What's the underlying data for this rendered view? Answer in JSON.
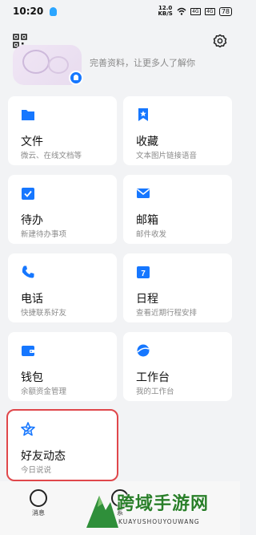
{
  "status_bar": {
    "time": "10:20",
    "speed_top": "12.0",
    "speed_bottom": "KB/S",
    "sig1": "4G",
    "sig2": "4G",
    "battery": "78"
  },
  "profile": {
    "hint": "完善资料，让更多人了解你"
  },
  "cards": [
    {
      "title": "文件",
      "sub": "微云、在线文档等",
      "icon": "folder-icon"
    },
    {
      "title": "收藏",
      "sub": "文本图片链接语音",
      "icon": "bookmark-star-icon"
    },
    {
      "title": "待办",
      "sub": "新建待办事项",
      "icon": "todo-check-icon"
    },
    {
      "title": "邮箱",
      "sub": "邮件收发",
      "icon": "mail-icon"
    },
    {
      "title": "电话",
      "sub": "快捷联系好友",
      "icon": "phone-icon"
    },
    {
      "title": "日程",
      "sub": "查看近期行程安排",
      "icon": "calendar-icon"
    },
    {
      "title": "钱包",
      "sub": "余额资金管理",
      "icon": "wallet-icon"
    },
    {
      "title": "工作台",
      "sub": "我的工作台",
      "icon": "planet-icon"
    },
    {
      "title": "好友动态",
      "sub": "今日说说",
      "icon": "star-z-icon"
    }
  ],
  "calendar_day": "7",
  "nav": {
    "messages_label": "消息",
    "second_label": "系"
  },
  "watermark": {
    "text": "跨域手游网",
    "sub": "KUAYUSHOUYOUWANG"
  },
  "colors": {
    "accent": "#1677ff",
    "highlight": "#e0474b"
  }
}
